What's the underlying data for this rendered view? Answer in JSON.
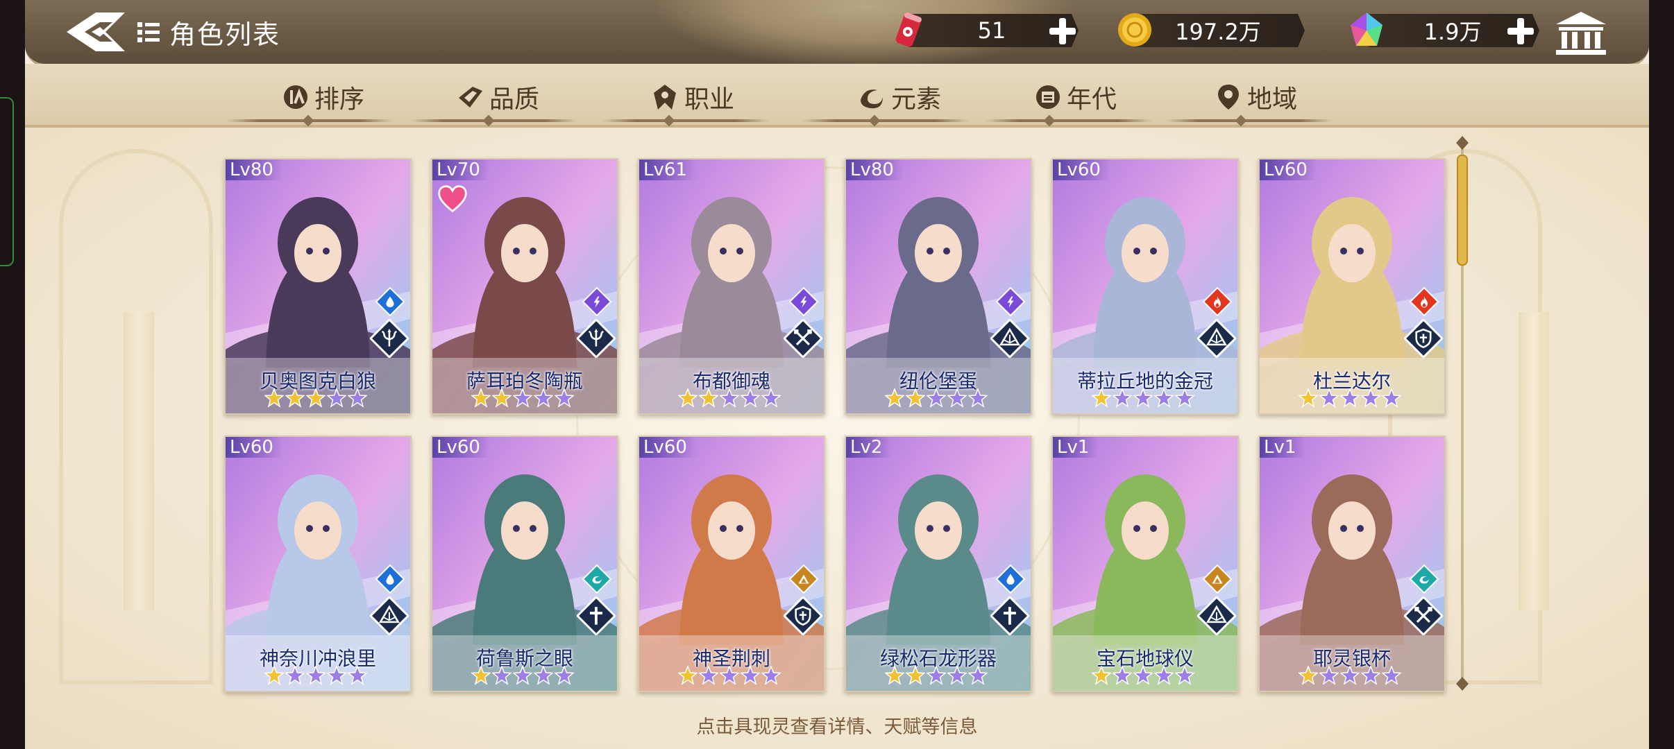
{
  "header": {
    "title": "角色列表",
    "resources": [
      {
        "name": "stamina",
        "icon": "red-can-icon",
        "value": "51",
        "has_plus": true
      },
      {
        "name": "gold",
        "icon": "gold-coin-icon",
        "value": "197.2万",
        "has_plus": false
      },
      {
        "name": "gem",
        "icon": "rainbow-gem-icon",
        "value": "1.9万",
        "has_plus": true
      }
    ]
  },
  "tabs": [
    {
      "label": "排序",
      "icon": "sort-icon"
    },
    {
      "label": "品质",
      "icon": "quality-icon"
    },
    {
      "label": "职业",
      "icon": "class-icon"
    },
    {
      "label": "元素",
      "icon": "element-icon"
    },
    {
      "label": "年代",
      "icon": "era-icon"
    },
    {
      "label": "地域",
      "icon": "location-icon"
    }
  ],
  "characters": [
    {
      "level": "80",
      "name": "贝奥图克白狼",
      "stars": 3,
      "element": "water",
      "role": "trident",
      "art": "#4a3a5a",
      "has_favorite": false
    },
    {
      "level": "70",
      "name": "萨耳珀冬陶瓶",
      "stars": 2,
      "element": "lightning",
      "role": "trident",
      "art": "#7a4a4a",
      "has_favorite": true
    },
    {
      "level": "61",
      "name": "布都御魂",
      "stars": 2,
      "element": "lightning",
      "role": "swords",
      "art": "#9a8a9a",
      "has_favorite": false
    },
    {
      "level": "80",
      "name": "纽伦堡蛋",
      "stars": 2,
      "element": "lightning",
      "role": "book",
      "art": "#6a6a8a",
      "has_favorite": false
    },
    {
      "level": "60",
      "name": "蒂拉丘地的金冠",
      "stars": 1,
      "element": "fire",
      "role": "book",
      "art": "#a9b6d8",
      "has_favorite": false
    },
    {
      "level": "60",
      "name": "杜兰达尔",
      "stars": 1,
      "element": "fire",
      "role": "shield",
      "art": "#e2c98a",
      "has_favorite": false
    },
    {
      "level": "60",
      "name": "神奈川冲浪里",
      "stars": 1,
      "element": "water",
      "role": "book",
      "art": "#b8c8e8",
      "has_favorite": false
    },
    {
      "level": "60",
      "name": "荷鲁斯之眼",
      "stars": 1,
      "element": "wind",
      "role": "cross",
      "art": "#4a7a7a",
      "has_favorite": false
    },
    {
      "level": "60",
      "name": "神圣荆刺",
      "stars": 1,
      "element": "earth",
      "role": "shield",
      "art": "#d07a4a",
      "has_favorite": false
    },
    {
      "level": "2",
      "name": "绿松石龙形器",
      "stars": 2,
      "element": "water",
      "role": "cross",
      "art": "#5a8a8a",
      "has_favorite": false
    },
    {
      "level": "1",
      "name": "宝石地球仪",
      "stars": 1,
      "element": "earth",
      "role": "book",
      "art": "#8ab85a",
      "has_favorite": false
    },
    {
      "level": "1",
      "name": "耶灵银杯",
      "stars": 1,
      "element": "wind",
      "role": "swords",
      "art": "#9a6a5a",
      "has_favorite": false
    }
  ],
  "lv_prefix": "Lv",
  "hint": "点击具现灵查看详情、天赋等信息",
  "colors": {
    "water": "#1e6fd8",
    "lightning": "#7a4ad8",
    "fire": "#e2361e",
    "wind": "#1fa8a8",
    "earth": "#c8861e",
    "star_on": "#f2c230",
    "star_off": "#9b7ee8"
  }
}
